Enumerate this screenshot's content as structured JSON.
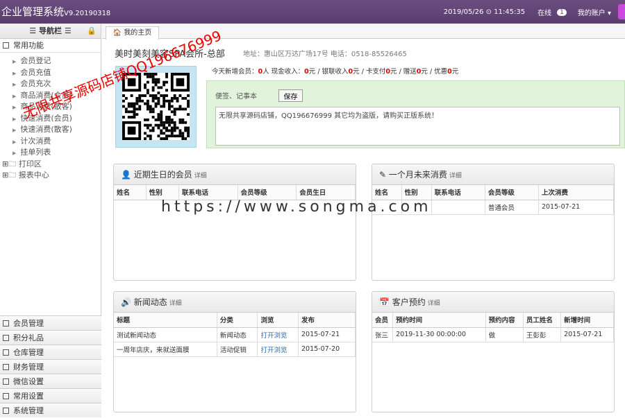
{
  "header": {
    "brand": "企业管理系统",
    "version": "V9.20190318",
    "datetime": "2019/05/26 ⊙ 11:45:35",
    "online_label": "在线",
    "online_count": "1",
    "account": "我的账户 ▾"
  },
  "sidebar": {
    "title": "☰ 导航栏 ☰",
    "common_group": "常用功能",
    "common_items": [
      "会员登记",
      "会员充值",
      "会员充次",
      "商品消费(会员)",
      "商品消费(散客)",
      "快速消费(会员)",
      "快速消费(散客)",
      "计次消费",
      "挂单列表"
    ],
    "tree_items": [
      "打印区",
      "报表中心"
    ],
    "bottom_groups": [
      "会员管理",
      "积分礼品",
      "仓库管理",
      "财务管理",
      "微信设置",
      "常用设置",
      "系统管理"
    ]
  },
  "tab": {
    "label": "我的主页"
  },
  "shop": {
    "name": "美时美刻美容SPA会所-总部",
    "address": "地址：惠山区万达广场17号 电话：0518-85526465"
  },
  "stats": {
    "new_members_label": "今天新增会员：",
    "new_members": "0",
    "cash_label": "人 现金收入：",
    "cash": "0",
    "bank_label": "元 / 银联收入",
    "bank": "0",
    "card_label": "元 / 卡支付",
    "card": "0",
    "gift_label": "元 / 赠送",
    "gift": "0",
    "discount_label": "元 / 优惠",
    "discount": "0",
    "unit": "元"
  },
  "note": {
    "label": "便签、记事本",
    "save": "保存",
    "text": "无限共享源码店铺，QQ196676999 其它均为盗版，请购买正版系统！"
  },
  "birthday": {
    "title": "近期生日的会员",
    "more": "详细",
    "columns": [
      "姓名",
      "性别",
      "联系电话",
      "会员等级",
      "会员生日"
    ]
  },
  "inactive": {
    "title": "一个月未来消费",
    "more": "详细",
    "columns": [
      "姓名",
      "性别",
      "联系电话",
      "会员等级",
      "上次消费"
    ],
    "rows": [
      [
        "",
        "",
        "",
        "普通会员",
        "2015-07-21"
      ]
    ]
  },
  "news": {
    "title": "新闻动态",
    "more": "详细",
    "columns": [
      "标题",
      "分类",
      "浏览",
      "发布"
    ],
    "rows": [
      [
        "测试新闻动态",
        "新闻动态",
        "打开浏览",
        "2015-07-21"
      ],
      [
        "一周年店庆，来就送面膜",
        "活动促销",
        "打开浏览",
        "2015-07-20"
      ]
    ]
  },
  "booking": {
    "title": "客户预约",
    "more": "详细",
    "columns": [
      "会员",
      "预约时间",
      "预约内容",
      "员工姓名",
      "新增时间"
    ],
    "rows": [
      [
        "张三",
        "2019-11-30 00:00:00",
        "做",
        "王彭彭",
        "2015-07-21"
      ]
    ]
  },
  "watermark": {
    "url": "https://www.songma.com",
    "red": "无限共享源码店铺QQ196676999"
  }
}
